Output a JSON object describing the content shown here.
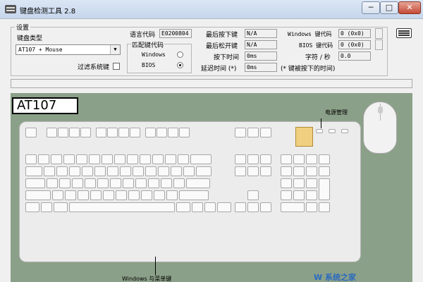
{
  "window": {
    "title": "键盘检测工具 2.8",
    "minimize_label": "─",
    "maximize_label": "□",
    "close_label": "✕"
  },
  "settings": {
    "group_title": "设置",
    "keyboard_type_label": "键盘类型",
    "keyboard_type_value": "AT107 + Mouse",
    "filter_system_keys_label": "过滤系统键",
    "filter_system_keys_checked": false,
    "language_code_label": "语言代码",
    "language_code_value": "E0200804",
    "match_code_group_title": "匹配键代码",
    "match_windows_label": "Windows",
    "match_bios_label": "BIOS",
    "match_selected": "BIOS",
    "last_pressed_label": "最后按下键",
    "last_pressed_value": "N/A",
    "last_released_label": "最后松开键",
    "last_released_value": "N/A",
    "press_time_label": "按下时间",
    "press_time_value": "0ms",
    "delay_time_label": "延迟时间 (*)",
    "delay_time_value": "0ms",
    "delay_time_note": "(* 键被按下的时间)",
    "windows_keycode_label": "Windows 键代码",
    "windows_keycode_value": "0 (0x0)",
    "bios_keycode_label": "BIOS 键代码",
    "bios_keycode_value": "0 (0x0)",
    "chars_per_sec_label": "字符 / 秒",
    "chars_per_sec_value": "0.0"
  },
  "keyboard_image": {
    "model_label": "AT107",
    "power_management_label": "电源管理",
    "windows_menu_label": "Windows 与菜单键"
  },
  "watermark": "W 系统之家"
}
